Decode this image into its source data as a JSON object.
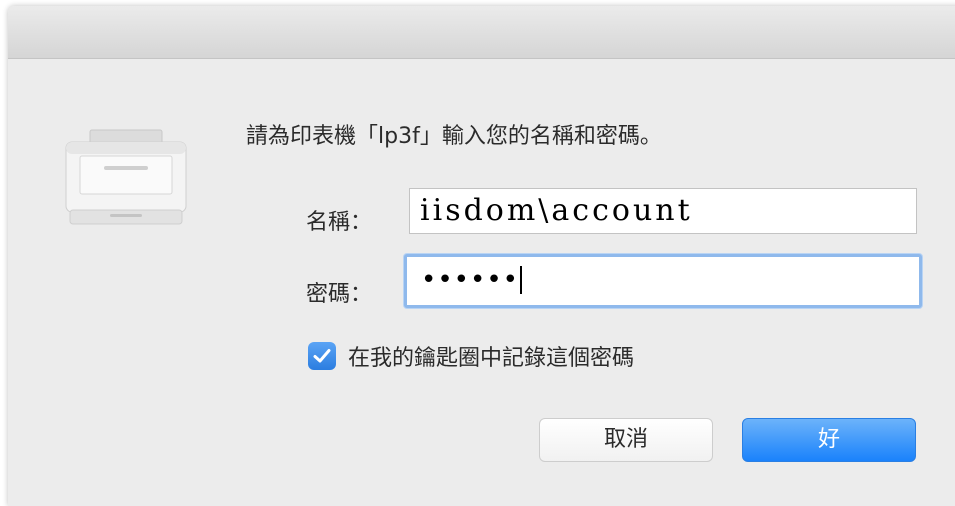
{
  "dialog": {
    "prompt": "請為印表機「lp3f」輸入您的名稱和密碼。",
    "icon": "printer-icon"
  },
  "name_field": {
    "label": "名稱：",
    "value": "iisdom\\account"
  },
  "password_field": {
    "label": "密碼：",
    "masked_value": "••••••"
  },
  "remember_checkbox": {
    "checked": true,
    "label": "在我的鑰匙圈中記錄這個密碼"
  },
  "buttons": {
    "cancel_label": "取消",
    "ok_label": "好"
  },
  "colors": {
    "accent": "#1a82fb",
    "focus_ring": "#8fb9ec",
    "dialog_bg": "#ececec"
  }
}
